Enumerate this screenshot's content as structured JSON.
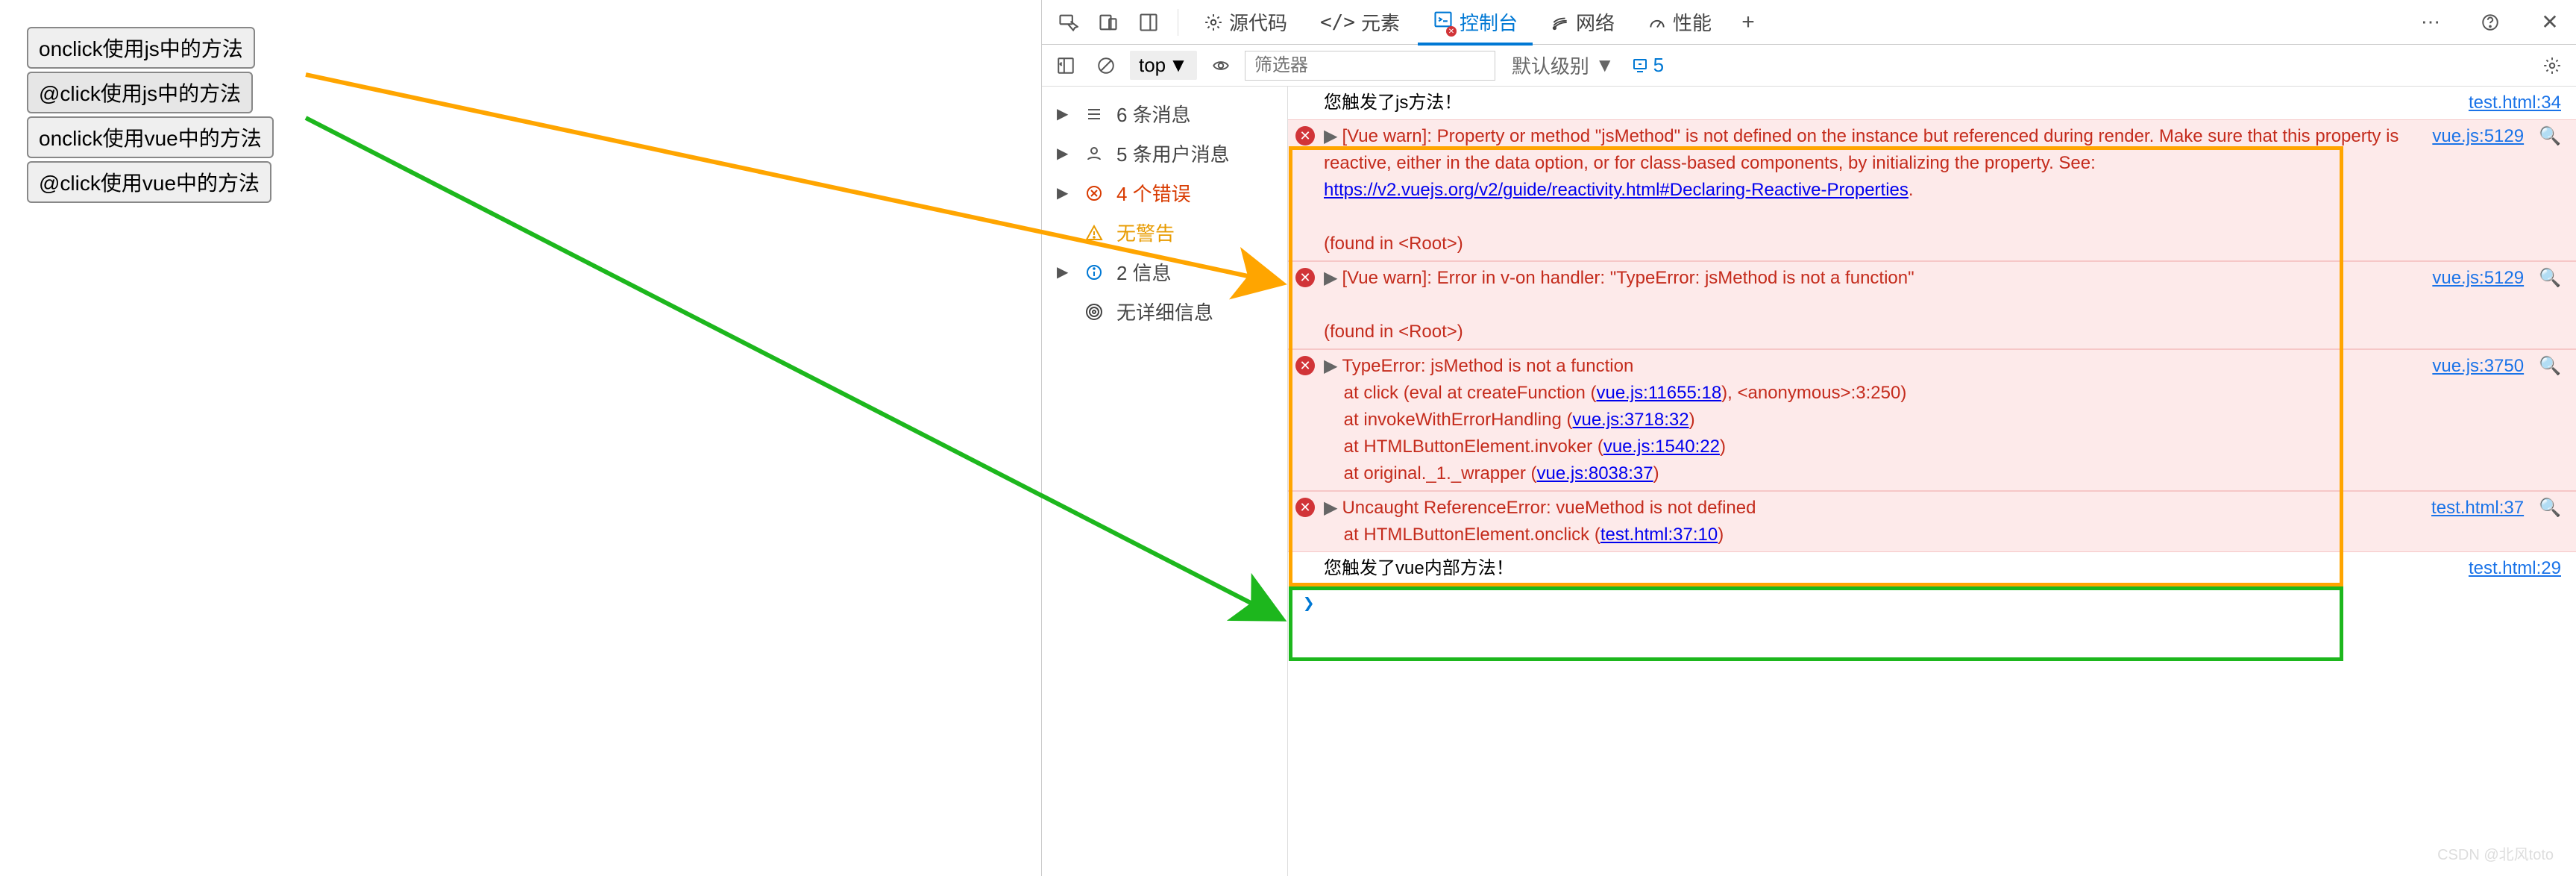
{
  "buttons": {
    "b1": "onclick使用js中的方法",
    "b2": "@click使用js中的方法",
    "b3": "onclick使用vue中的方法",
    "b4": "@click使用vue中的方法"
  },
  "tabs": {
    "sources": "源代码",
    "elements": "元素",
    "console": "控制台",
    "network": "网络",
    "performance": "性能"
  },
  "filter": {
    "top": "top",
    "placeholder": "筛选器",
    "level": "默认级别",
    "issue_count": "5"
  },
  "sidebar": {
    "messages": "6 条消息",
    "user": "5 条用户消息",
    "errors": "4 个错误",
    "warnings": "无警告",
    "info": "2 信息",
    "verbose": "无详细信息"
  },
  "logs": {
    "l1_msg": "您触发了js方法！",
    "l1_src": "test.html:34",
    "l2_pre": "[Vue warn]: Property or method \"jsMethod\" is not defined on the instance but referenced during render. Make sure that this property is reactive, either in the data option, or for class-based components, by initializing the property. See: ",
    "l2_link": "https://v2.vuejs.org/v2/guide/reactivity.html#Declaring-Reactive-Properties",
    "l2_post": ".",
    "l2_found": "(found in <Root>)",
    "l2_src": "vue.js:5129",
    "l3_msg": "[Vue warn]: Error in v-on handler: \"TypeError: jsMethod is not a function\"",
    "l3_found": "(found in <Root>)",
    "l3_src": "vue.js:5129",
    "l4_msg": "TypeError: jsMethod is not a function",
    "l4_at1_pre": "    at click (eval at createFunction (",
    "l4_at1_link": "vue.js:11655:18",
    "l4_at1_post": "), <anonymous>:3:250)",
    "l4_at2_pre": "    at invokeWithErrorHandling (",
    "l4_at2_link": "vue.js:3718:32",
    "l4_at2_post": ")",
    "l4_at3_pre": "    at HTMLButtonElement.invoker (",
    "l4_at3_link": "vue.js:1540:22",
    "l4_at3_post": ")",
    "l4_at4_pre": "    at original._1._wrapper (",
    "l4_at4_link": "vue.js:8038:37",
    "l4_at4_post": ")",
    "l4_src": "vue.js:3750",
    "l5_msg": "Uncaught ReferenceError: vueMethod is not defined",
    "l5_at_pre": "    at HTMLButtonElement.onclick (",
    "l5_at_link": "test.html:37:10",
    "l5_at_post": ")",
    "l5_src": "test.html:37",
    "l6_msg": "您触发了vue内部方法！",
    "l6_src": "test.html:29",
    "prompt": "❯"
  },
  "watermark": "CSDN @北风toto"
}
